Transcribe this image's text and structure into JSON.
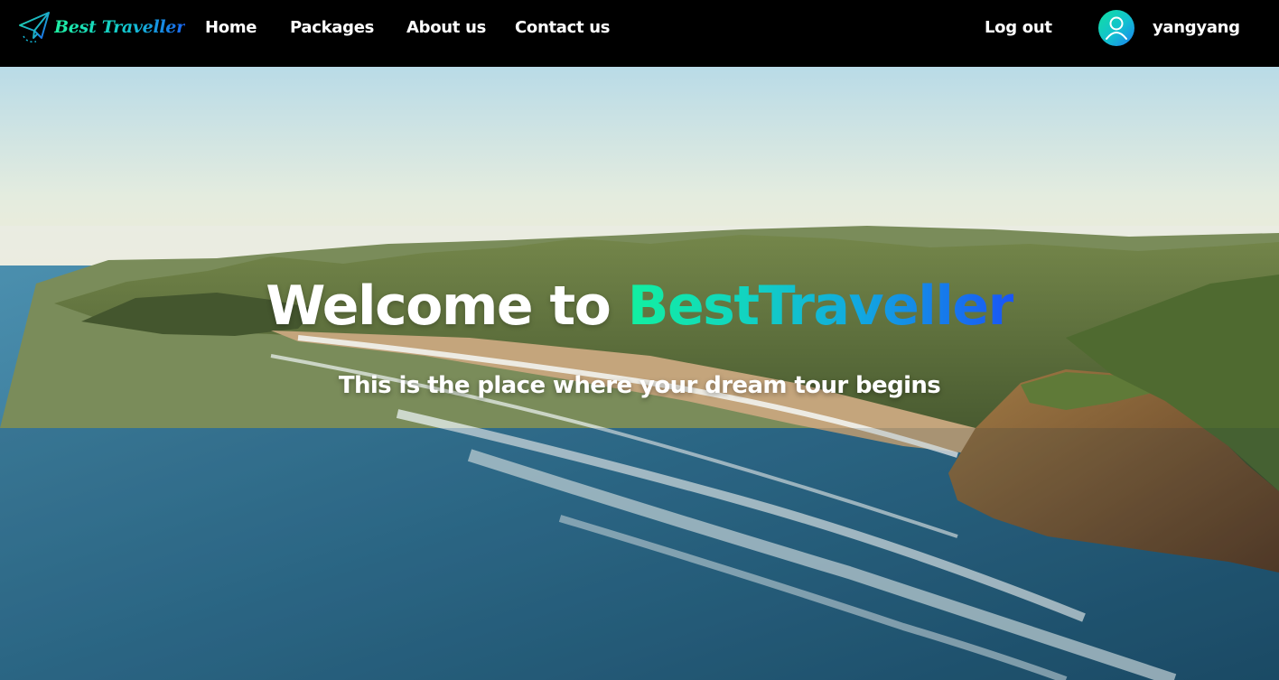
{
  "brand": {
    "logo_text": "Best Traveller",
    "logo_icon": "paper-plane-icon",
    "accent_from": "#12f0a0",
    "accent_to": "#1a55f5"
  },
  "nav": {
    "items": [
      {
        "label": "Home"
      },
      {
        "label": "Packages"
      },
      {
        "label": "About us"
      },
      {
        "label": "Contact us"
      }
    ],
    "logout_label": "Log out",
    "user": {
      "avatar_icon": "user-icon",
      "name": "yangyang"
    }
  },
  "hero": {
    "title_prefix": "Welcome to ",
    "title_brand": "BestTraveller",
    "subtitle": "This is the place where your dream tour begins",
    "background": "coastal-landscape-image"
  }
}
